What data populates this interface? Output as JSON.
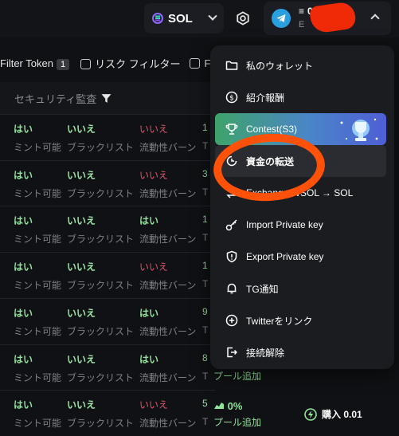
{
  "topbar": {
    "chain_label": "SOL",
    "balance_prefix": "≡",
    "balance_visible": "0.",
    "address_visible": "E"
  },
  "filters": {
    "filter_token_label": "Filter Token",
    "filter_token_count": "1",
    "risk_filter_label": "リスク フィルター",
    "third_filter_label": "Filte"
  },
  "table": {
    "security_header": "セキュリティ監査",
    "col_labels": [
      "ミント可能",
      "ブラックリスト",
      "流動性バーン"
    ],
    "rows": [
      {
        "mint": "はい",
        "black": "いいえ",
        "burn": "いいえ",
        "extra": "1",
        "extra_sub": "T"
      },
      {
        "mint": "はい",
        "black": "いいえ",
        "burn": "いいえ",
        "extra": "3",
        "extra_sub": "T"
      },
      {
        "mint": "はい",
        "black": "いいえ",
        "burn": "はい",
        "extra": "1",
        "extra_sub": "T"
      },
      {
        "mint": "はい",
        "black": "いいえ",
        "burn": "いいえ",
        "extra": "1",
        "extra_sub": "T"
      },
      {
        "mint": "はい",
        "black": "いいえ",
        "burn": "はい",
        "extra": "9",
        "extra_sub": "T"
      },
      {
        "mint": "はい",
        "black": "いいえ",
        "burn": "はい",
        "extra": "8",
        "extra_sub": "T"
      },
      {
        "mint": "はい",
        "black": "いいえ",
        "burn": "いいえ",
        "extra": "5",
        "extra_sub": "T"
      }
    ],
    "row6_pool_partial": "プール追加",
    "last_row_pct": "0%",
    "last_row_pool": "プール追加",
    "buy_label": "購入 0.01"
  },
  "menu": {
    "items": [
      {
        "label": "私のウォレット",
        "icon": "folder-icon"
      },
      {
        "label": "紹介報酬",
        "icon": "dollar-circle-icon"
      },
      {
        "label": "Contest(S3)",
        "icon": "trophy-icon"
      },
      {
        "label": "資金の転送",
        "icon": "transfer-icon"
      },
      {
        "label": "Exchange WSOL → SOL",
        "icon": "exchange-icon"
      },
      {
        "label": "Import Private key",
        "icon": "key-icon"
      },
      {
        "label": "Export Private key",
        "icon": "shield-icon"
      },
      {
        "label": "TG通知",
        "icon": "bell-icon"
      },
      {
        "label": "Twitterをリンク",
        "icon": "plus-circle-icon"
      },
      {
        "label": "接続解除",
        "icon": "logout-icon"
      }
    ]
  },
  "colors": {
    "accent_green": "#8ee29a",
    "danger_red": "#e0556b",
    "highlight_orange": "#ff5208",
    "redaction_red": "#f02a06"
  }
}
